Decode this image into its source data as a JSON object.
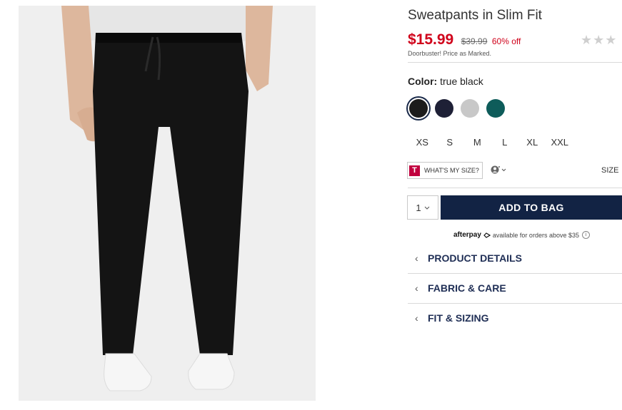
{
  "product": {
    "title": "Sweatpants in Slim Fit",
    "sale_price": "$15.99",
    "original_price": "$39.99",
    "discount": "60% off",
    "note": "Doorbuster! Price as Marked.",
    "rating_stars": "★★★"
  },
  "color": {
    "label": "Color:",
    "selected": "true black",
    "swatches": [
      "#1c1c1c",
      "#1e2036",
      "#c8c8c8",
      "#0e5c5a"
    ]
  },
  "sizes": [
    "XS",
    "S",
    "M",
    "L",
    "XL",
    "XXL"
  ],
  "fit_tools": {
    "whats_my_size": "WHAT'S MY SIZE?",
    "t_badge": "T",
    "size_link": "SIZE"
  },
  "purchase": {
    "quantity": "1",
    "add_to_bag": "ADD TO BAG"
  },
  "afterpay": {
    "logo": "afterpay",
    "text": "available for orders above $35"
  },
  "accordion": [
    {
      "label": "PRODUCT DETAILS"
    },
    {
      "label": "FABRIC & CARE"
    },
    {
      "label": "FIT & SIZING"
    }
  ],
  "colors": {
    "sale_red": "#d0021b",
    "button_navy": "#122344",
    "link_navy": "#1f2e55"
  },
  "icons": {
    "chevron": "chevron-left-icon",
    "profile": "user-icon",
    "info": "info-icon"
  }
}
